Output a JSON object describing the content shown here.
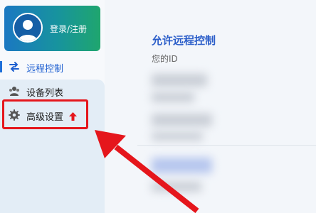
{
  "login": {
    "label": "登录/注册"
  },
  "nav": {
    "remote_control": "远程控制",
    "device_list": "设备列表",
    "advanced_settings": "高级设置"
  },
  "main": {
    "title": "允许远程控制",
    "your_id_label": "您的ID"
  },
  "colors": {
    "accent": "#1e5fd0",
    "highlight": "#e5161c",
    "login_gradient_start": "#1b78c2",
    "login_gradient_end": "#1fa66e"
  },
  "icons": {
    "avatar": "user-avatar-icon",
    "remote": "swap-arrows-icon",
    "devices": "users-icon",
    "settings": "gear-icon",
    "badge": "red-up-arrow-icon"
  }
}
